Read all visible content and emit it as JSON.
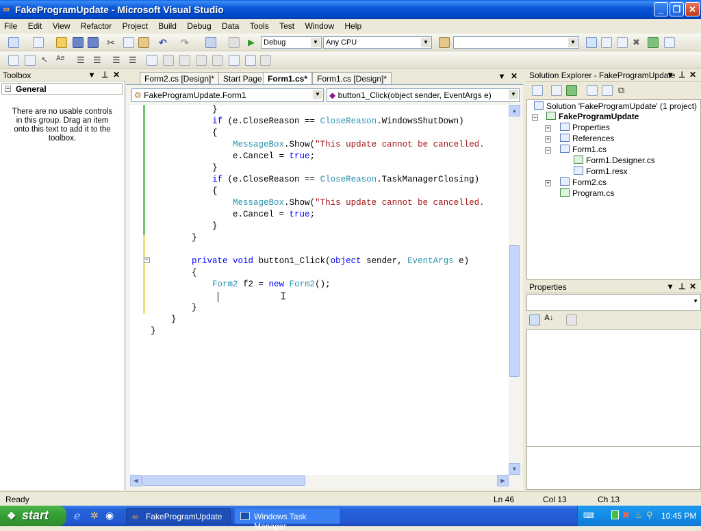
{
  "window": {
    "title": "FakeProgramUpdate - Microsoft Visual Studio"
  },
  "menu": [
    "File",
    "Edit",
    "View",
    "Refactor",
    "Project",
    "Build",
    "Debug",
    "Data",
    "Tools",
    "Test",
    "Window",
    "Help"
  ],
  "toolbar": {
    "config": "Debug",
    "platform": "Any CPU",
    "find": ""
  },
  "toolbox": {
    "title": "Toolbox",
    "group": "General",
    "empty_message": "There are no usable controls in this group. Drag an item onto this text to add it to the toolbox."
  },
  "editor": {
    "tabs": [
      "Form2.cs [Design]*",
      "Start Page",
      "Form1.cs*",
      "Form1.cs [Design]*"
    ],
    "active_tab": 2,
    "class_combo": "FakeProgramUpdate.Form1",
    "member_combo": "button1_Click(object sender, EventArgs e)"
  },
  "code": [
    {
      "indent": "            ",
      "parts": [
        [
          "p",
          "}"
        ]
      ]
    },
    {
      "indent": "            ",
      "parts": [
        [
          "k",
          "if"
        ],
        [
          "p",
          " (e.CloseReason == "
        ],
        [
          "t",
          "CloseReason"
        ],
        [
          "p",
          ".WindowsShutDown)"
        ]
      ]
    },
    {
      "indent": "            ",
      "parts": [
        [
          "p",
          "{"
        ]
      ]
    },
    {
      "indent": "                ",
      "parts": [
        [
          "t",
          "MessageBox"
        ],
        [
          "p",
          ".Show("
        ],
        [
          "s",
          "\"This update cannot be cancelled."
        ]
      ]
    },
    {
      "indent": "                ",
      "parts": [
        [
          "p",
          "e.Cancel = "
        ],
        [
          "k",
          "true"
        ],
        [
          "p",
          ";"
        ]
      ]
    },
    {
      "indent": "            ",
      "parts": [
        [
          "p",
          "}"
        ]
      ]
    },
    {
      "indent": "            ",
      "parts": [
        [
          "k",
          "if"
        ],
        [
          "p",
          " (e.CloseReason == "
        ],
        [
          "t",
          "CloseReason"
        ],
        [
          "p",
          ".TaskManagerClosing)"
        ]
      ]
    },
    {
      "indent": "            ",
      "parts": [
        [
          "p",
          "{"
        ]
      ]
    },
    {
      "indent": "                ",
      "parts": [
        [
          "t",
          "MessageBox"
        ],
        [
          "p",
          ".Show("
        ],
        [
          "s",
          "\"This update cannot be cancelled."
        ]
      ]
    },
    {
      "indent": "                ",
      "parts": [
        [
          "p",
          "e.Cancel = "
        ],
        [
          "k",
          "true"
        ],
        [
          "p",
          ";"
        ]
      ]
    },
    {
      "indent": "            ",
      "parts": [
        [
          "p",
          "}"
        ]
      ]
    },
    {
      "indent": "        ",
      "parts": [
        [
          "p",
          "}"
        ]
      ]
    },
    {
      "indent": "",
      "parts": []
    },
    {
      "indent": "        ",
      "parts": [
        [
          "k",
          "private"
        ],
        [
          "p",
          " "
        ],
        [
          "k",
          "void"
        ],
        [
          "p",
          " button1_Click("
        ],
        [
          "k",
          "object"
        ],
        [
          "p",
          " sender, "
        ],
        [
          "t",
          "EventArgs"
        ],
        [
          "p",
          " e)"
        ]
      ]
    },
    {
      "indent": "        ",
      "parts": [
        [
          "p",
          "{"
        ]
      ]
    },
    {
      "indent": "            ",
      "parts": [
        [
          "t",
          "Form2"
        ],
        [
          "p",
          " f2 = "
        ],
        [
          "k",
          "new"
        ],
        [
          "p",
          " "
        ],
        [
          "t",
          "Form2"
        ],
        [
          "p",
          "();"
        ]
      ]
    },
    {
      "indent": "            ",
      "parts": []
    },
    {
      "indent": "        ",
      "parts": [
        [
          "p",
          "}"
        ]
      ]
    },
    {
      "indent": "    ",
      "parts": [
        [
          "p",
          "}"
        ]
      ]
    },
    {
      "indent": "",
      "parts": [
        [
          "p",
          "}"
        ]
      ]
    }
  ],
  "solution_explorer": {
    "title": "Solution Explorer - FakeProgramUpdate",
    "items": [
      "Solution 'FakeProgramUpdate' (1 project)",
      "FakeProgramUpdate",
      "Properties",
      "References",
      "Form1.cs",
      "Form1.Designer.cs",
      "Form1.resx",
      "Form2.cs",
      "Program.cs"
    ]
  },
  "properties": {
    "title": "Properties"
  },
  "status": {
    "text": "Ready",
    "line": "Ln 46",
    "col": "Col 13",
    "ch": "Ch 13"
  },
  "taskbar": {
    "start": "start",
    "tasks": [
      "FakeProgramUpdate ...",
      "Windows Task Manager"
    ],
    "clock": "10:45 PM"
  },
  "colors": {
    "keyword": "#0000ff",
    "type": "#2b91af",
    "string": "#a31515",
    "titlebar": "#0a58d8"
  }
}
